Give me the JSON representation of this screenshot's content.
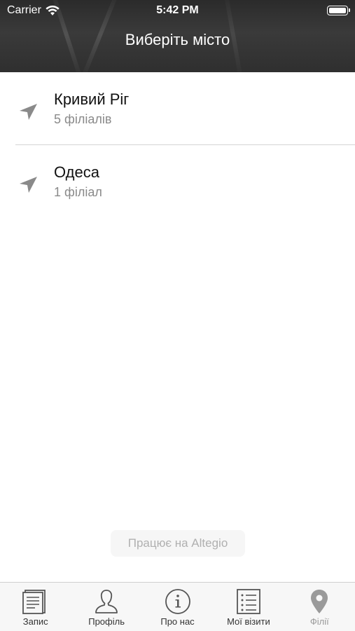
{
  "status_bar": {
    "carrier": "Carrier",
    "time": "5:42 PM"
  },
  "header": {
    "title": "Виберіть місто"
  },
  "cities": [
    {
      "name": "Кривий Ріг",
      "branches": "5 філіалів"
    },
    {
      "name": "Одеса",
      "branches": "1 філіал"
    }
  ],
  "footer": {
    "powered_by": "Працює на Altegio"
  },
  "tabbar": {
    "items": [
      {
        "label": "Запис",
        "icon": "document-icon"
      },
      {
        "label": "Профіль",
        "icon": "person-icon"
      },
      {
        "label": "Про нас",
        "icon": "info-icon"
      },
      {
        "label": "Мої візити",
        "icon": "list-icon"
      },
      {
        "label": "Філії",
        "icon": "map-pin-icon",
        "active": true
      }
    ]
  },
  "colors": {
    "header_bg": "#2f2f2f",
    "active_tab": "#9a9a9a",
    "subtext": "#8a8a8a"
  }
}
